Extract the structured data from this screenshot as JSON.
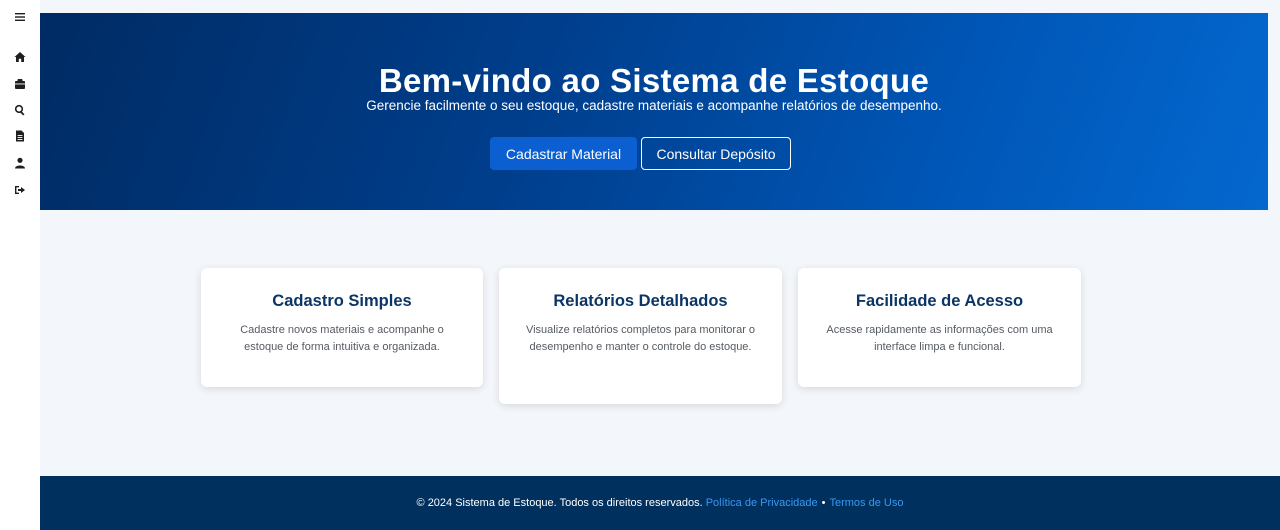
{
  "sidebar": {
    "icons": [
      "menu-icon",
      "home-icon",
      "box-icon",
      "search-icon",
      "document-icon",
      "user-icon",
      "logout-icon"
    ]
  },
  "hero": {
    "title": "Bem-vindo ao Sistema de Estoque",
    "subtitle": "Gerencie facilmente o seu estoque, cadastre materiais e acompanhe relatórios de desempenho.",
    "primary_button": "Cadastrar Material",
    "secondary_button": "Consultar Depósito"
  },
  "features": [
    {
      "title": "Cadastro Simples",
      "text": "Cadastre novos materiais e acompanhe o estoque de forma intuitiva e organizada."
    },
    {
      "title": "Relatórios Detalhados",
      "text": "Visualize relatórios completos para monitorar o desempenho e manter o controle do estoque."
    },
    {
      "title": "Facilidade de Acesso",
      "text": "Acesse rapidamente as informações com uma interface limpa e funcional."
    }
  ],
  "footer": {
    "copyright": "© 2024 Sistema de Estoque. Todos os direitos reservados.",
    "privacy_link": "Política de Privacidade",
    "separator": "•",
    "terms_link": "Termos de Uso"
  },
  "colors": {
    "hero_start": "#002b63",
    "hero_end": "#0468cf",
    "primary_button": "#0b5fd0",
    "footer_bg": "#00305e",
    "link": "#3b97f0",
    "card_title": "#0b3565"
  }
}
